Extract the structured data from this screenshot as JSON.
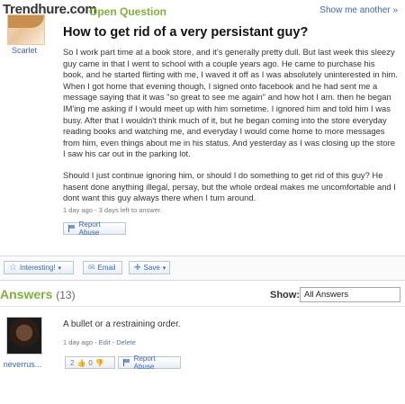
{
  "watermark": "Trendhure.com",
  "header": {
    "open_question": "Open Question",
    "show_another": "Show me another »"
  },
  "asker": {
    "name": "Scarlet"
  },
  "question": {
    "title": "How to get rid of a very persistant guy?",
    "paragraph1": "So I work part time at a book store, and it's generally pretty dull. But last week this sleezy guy came in that I went to school with a couple years ago. He came to purchase his book, and he started flirting with me, I waved it off as I was absolutely uninterested in him. When I got home that evening though, I signed onto facebook and he had sent me a message saying that it was \"so great to see me again\" and how hot I am. then he began IM'ing me asking if I would meet up with him sometime. I ignored him and told him I was busy. After that I wouldn't think much of it, but he began coming into the store everyday reading books and watching me, and everyday I would come home to more messages from him, even things about me in his status. And yesterday as I was closing up the store I saw his car out in the parking lot.",
    "paragraph2": "Should I just continue ignoring him, or should I do something to get rid of this guy? He hasent done anything illegal, persay, but the whole ordeal makes me uncomfortable and I dont want this guy always there when I turn around.",
    "meta": "1 day ago - 3 days left to answer.",
    "report_label": "Report Abuse"
  },
  "toolbar": {
    "interesting_label": "Interesting!",
    "email_label": "Email",
    "save_label": "Save"
  },
  "answers": {
    "heading": "Answers",
    "count": "(13)",
    "show_label": "Show:",
    "show_selected": "All Answers",
    "items": [
      {
        "author": "neverrus...",
        "text": "A bullet or a restraining order.",
        "time": "1 day ago",
        "edit_label": "Edit",
        "delete_label": "Delete",
        "thumbs_up": "2",
        "thumbs_down": "0",
        "report_label": "Report Abuse"
      }
    ]
  }
}
